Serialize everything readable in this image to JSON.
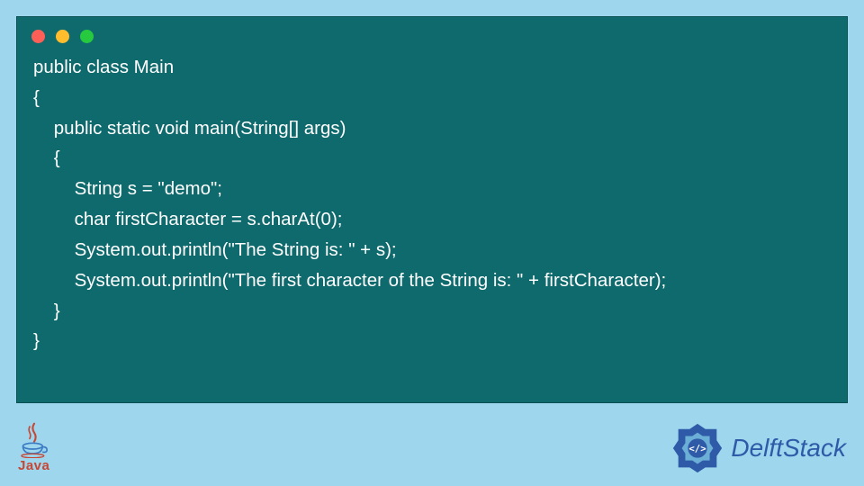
{
  "code": {
    "lines": [
      "public class Main",
      "{",
      "    public static void main(String[] args)",
      "    {",
      "        String s = \"demo\";",
      "        char firstCharacter = s.charAt(0);",
      "        System.out.println(\"The String is: \" + s);",
      "        System.out.println(\"The first character of the String is: \" + firstCharacter);",
      "    }",
      "}"
    ]
  },
  "footer": {
    "java_label": "Java",
    "brand_label": "DelftStack"
  }
}
